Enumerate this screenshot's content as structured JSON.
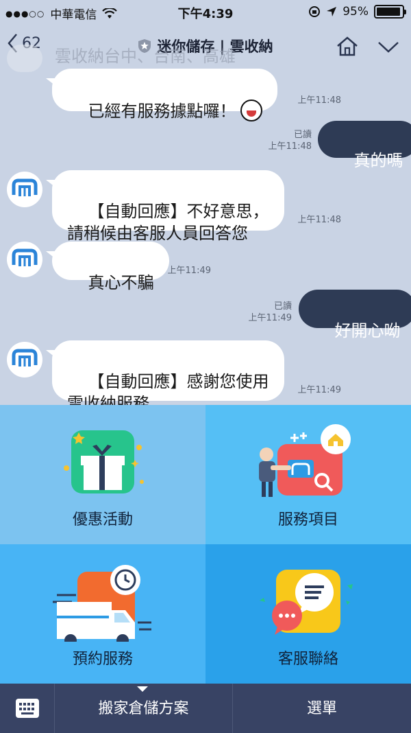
{
  "status_bar": {
    "carrier": "中華電信",
    "time": "下午4:39",
    "battery": "95%",
    "battery_level": 0.95
  },
  "header": {
    "back_count": "62",
    "title": "迷你儲存 | 雲收納"
  },
  "chat": {
    "ghost_text": "雲收納台中、台南、高雄",
    "messages": [
      {
        "side": "in",
        "text": "已經有服務據點囉！",
        "time": "上午11:48"
      },
      {
        "side": "out",
        "text": "真的嗎",
        "read": "已讀",
        "time": "上午11:48"
      },
      {
        "side": "in",
        "text": "【自動回應】不好意思，\n請稍候由客服人員回答您",
        "time": "上午11:48"
      },
      {
        "side": "in",
        "text": "真心不騙",
        "time": "上午11:49"
      },
      {
        "side": "out",
        "text": "好開心呦",
        "read": "已讀",
        "time": "上午11:49"
      },
      {
        "side": "in",
        "text": "【自動回應】感謝您使用\n雲收納服務",
        "time": "上午11:49"
      }
    ]
  },
  "rich_menu": {
    "tiles": [
      {
        "label": "優惠活動",
        "icon": "gift-icon",
        "bg": "#7cc3f0"
      },
      {
        "label": "服務項目",
        "icon": "service-items-icon",
        "bg": "#55bff5"
      },
      {
        "label": "預約服務",
        "icon": "delivery-truck-icon",
        "bg": "#48b4f5"
      },
      {
        "label": "客服聯絡",
        "icon": "chat-support-icon",
        "bg": "#2aa1ea"
      }
    ]
  },
  "bottom_bar": {
    "title": "搬家倉儲方案",
    "menu_label": "選單"
  },
  "colors": {
    "chat_bg": "#c9d3e4",
    "outgoing_bubble": "#2e3b55",
    "bottom_bar": "#384364"
  }
}
